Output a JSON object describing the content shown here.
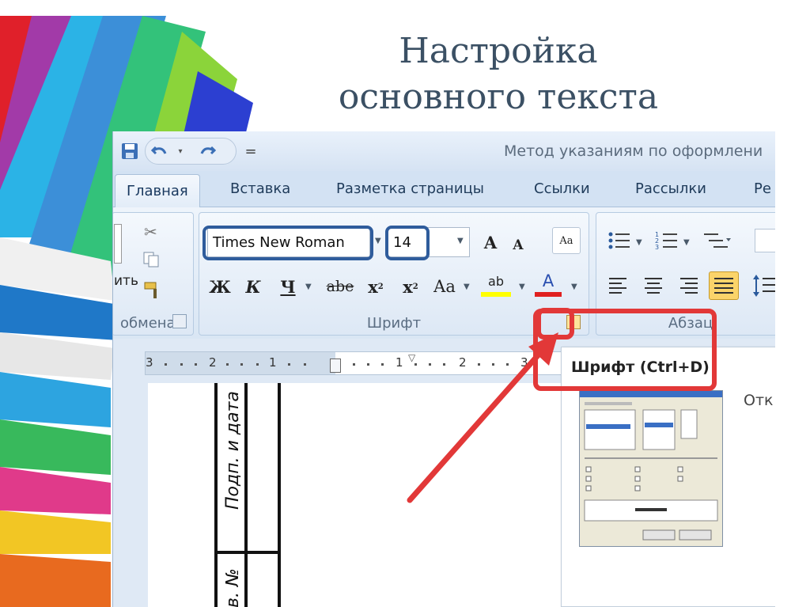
{
  "slide": {
    "title_line1": "Настройка",
    "title_line2": "основного текста"
  },
  "qat": {
    "save_icon": "save-icon",
    "undo_icon": "undo-icon",
    "redo_icon": "redo-icon",
    "customize_symbol": "="
  },
  "window": {
    "title": "Метод указаниям по оформлени"
  },
  "tabs": [
    "Главная",
    "Вставка",
    "Разметка страницы",
    "Ссылки",
    "Рассылки",
    "Ре"
  ],
  "clipboard": {
    "label": "обмена",
    "paste_label": "ить"
  },
  "font": {
    "name_value": "Times New Roman",
    "size_value": "14",
    "grow_label": "A",
    "shrink_label": "A",
    "clear_label": "Aa",
    "bold": "Ж",
    "italic": "К",
    "underline": "Ч",
    "strike": "abe",
    "subscript": "x",
    "superscript": "x",
    "case": "Aa",
    "highlight_label": "ab",
    "color_label": "A",
    "group_label": "Шрифт"
  },
  "paragraph": {
    "group_label": "Абзац"
  },
  "ruler": {
    "numbers": [
      "3",
      "2",
      "1",
      "1",
      "2",
      "3"
    ]
  },
  "page": {
    "vertical_text_1": "Подп. и дата",
    "vertical_text_2": "в. №"
  },
  "tooltip": {
    "title": "Шрифт (Ctrl+D)",
    "side_text": "Отк"
  },
  "colors": {
    "accent_red": "#e23838",
    "highlight_blue": "#2f5c9c",
    "ribbon_bg": "#dfe9f5",
    "highlight_yellow": "#ffff00",
    "font_color_red": "#e02020"
  }
}
